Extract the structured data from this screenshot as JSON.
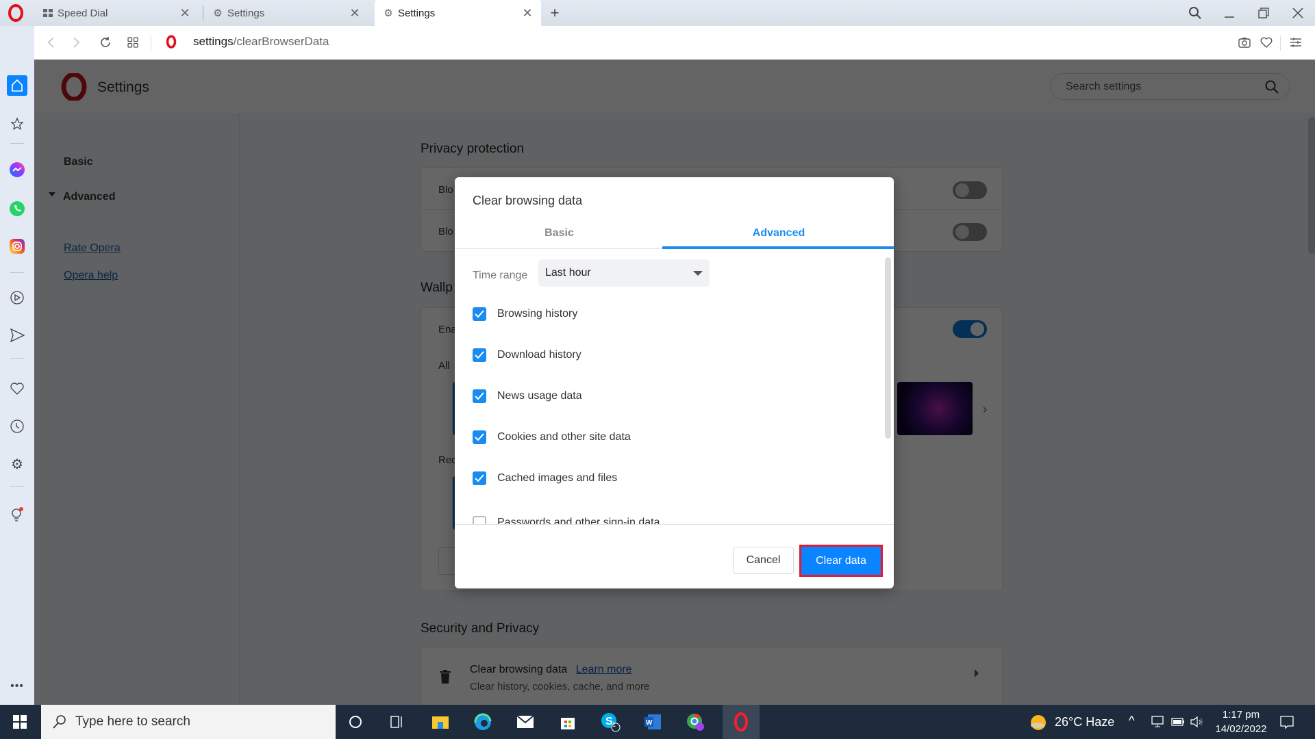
{
  "browser": {
    "tabs": [
      {
        "label": "Speed Dial",
        "icon": "speed-dial-icon",
        "active": false
      },
      {
        "label": "Settings",
        "icon": "gear-icon",
        "active": false
      },
      {
        "label": "Settings",
        "icon": "gear-icon",
        "active": true
      }
    ],
    "new_tab_icon": "plus-icon",
    "address": {
      "host": "settings",
      "path": "/clearBrowserData"
    },
    "window_controls": [
      "search-icon",
      "minimize-icon",
      "restore-icon",
      "close-icon"
    ],
    "toolbar_right": [
      "camera-icon",
      "heart-icon",
      "easy-setup-icon"
    ]
  },
  "sidebar": {
    "items": [
      "home-icon",
      "star-icon",
      "messenger-icon",
      "whatsapp-icon",
      "instagram-icon",
      "player-icon",
      "send-icon",
      "heart-icon",
      "history-icon",
      "settings-icon",
      "lightbulb-icon"
    ],
    "more_icon": "more-icon"
  },
  "settings": {
    "title": "Settings",
    "search_placeholder": "Search settings",
    "nav": {
      "basic": "Basic",
      "advanced": "Advanced",
      "rate": "Rate Opera",
      "help": "Opera help"
    },
    "sections": {
      "privacy": {
        "title": "Privacy protection",
        "row1": "Blo",
        "row2": "Blo"
      },
      "wallpapers": {
        "title": "Wallp",
        "enable": "Ena",
        "all": "All",
        "recent": "Rec"
      },
      "security": {
        "title": "Security and Privacy",
        "clear_title": "Clear browsing data",
        "learn_more": "Learn more",
        "clear_desc": "Clear history, cookies, cache, and more"
      }
    }
  },
  "dialog": {
    "title": "Clear browsing data",
    "tabs": {
      "basic": "Basic",
      "advanced": "Advanced",
      "active": "advanced"
    },
    "time_range": {
      "label": "Time range",
      "value": "Last hour"
    },
    "options": [
      {
        "label": "Browsing history",
        "checked": true
      },
      {
        "label": "Download history",
        "checked": true
      },
      {
        "label": "News usage data",
        "checked": true
      },
      {
        "label": "Cookies and other site data",
        "checked": true
      },
      {
        "label": "Cached images and files",
        "checked": true
      },
      {
        "label": "Passwords and other sign-in data",
        "checked": false
      }
    ],
    "cancel": "Cancel",
    "confirm": "Clear data"
  },
  "taskbar": {
    "search_placeholder": "Type here to search",
    "weather": "26°C  Haze",
    "time": "1:17 pm",
    "date": "14/02/2022",
    "skype_badge": "1"
  },
  "colors": {
    "accent": "#1a8cf0",
    "highlight": "#e8192c",
    "opera_red": "#e0101a"
  }
}
